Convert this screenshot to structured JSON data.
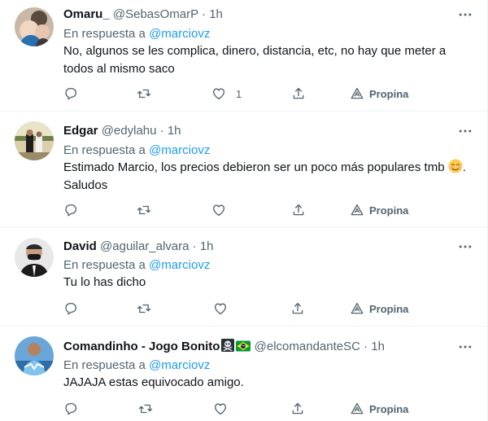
{
  "tweets": [
    {
      "name": "Omaru_",
      "handle": "@SebasOmarP",
      "sep": "·",
      "time": "1h",
      "reply_prefix": "En respuesta a",
      "reply_to": "@marciovz",
      "text_1": "No, algunos se les complica, dinero, distancia, etc, no hay que meter a",
      "text_2": "todos al mismo saco",
      "likes": "1",
      "tip_label": "Propina"
    },
    {
      "name": "Edgar",
      "handle": "@edylahu",
      "sep": "·",
      "time": "1h",
      "reply_prefix": "En respuesta a",
      "reply_to": "@marciovz",
      "text_1": "Estimado Marcio, los precios debieron ser un poco más populares tmb",
      "text_1_after": ".",
      "text_2": "Saludos",
      "tip_label": "Propina"
    },
    {
      "name": "David",
      "handle": "@aguilar_alvara",
      "sep": "·",
      "time": "1h",
      "reply_prefix": "En respuesta a",
      "reply_to": "@marciovz",
      "text_1": "Tu lo has dicho",
      "tip_label": "Propina"
    },
    {
      "name": "Comandinho - Jogo Bonito",
      "handle": "@elcomandanteSC",
      "sep": "·",
      "time": "1h",
      "reply_prefix": "En respuesta a",
      "reply_to": "@marciovz",
      "text_1": "JAJAJA estas equivocado amigo.",
      "tip_label": "Propina"
    }
  ],
  "icons": [
    "more-icon",
    "reply-icon",
    "retweet-icon",
    "like-icon",
    "share-icon",
    "tip-icon",
    "smiling-face-emoji",
    "skull-crossbones-emoji",
    "brazil-flag-emoji"
  ],
  "colors": {
    "accent": "#1d9bf0",
    "secondary_text": "#536471",
    "primary_text": "#0f1419",
    "divider": "#eff3f4"
  }
}
